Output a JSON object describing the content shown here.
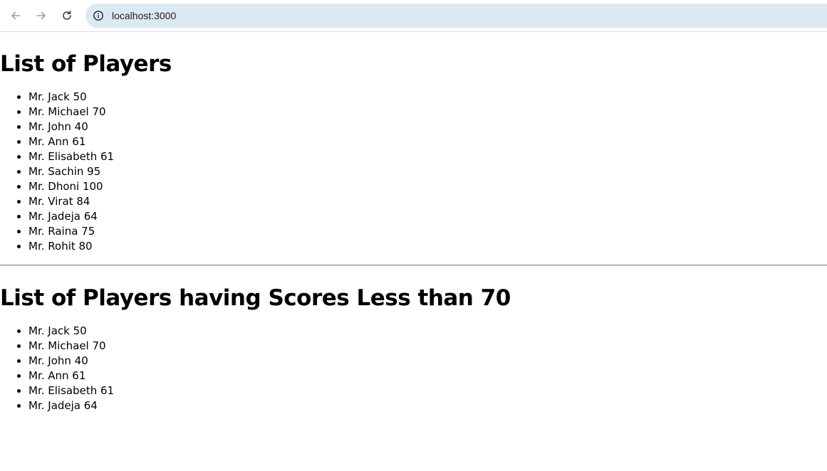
{
  "browser": {
    "url": "localhost:3000"
  },
  "section_all": {
    "title": "List of Players",
    "players": [
      "Mr. Jack 50",
      "Mr. Michael 70",
      "Mr. John 40",
      "Mr. Ann 61",
      "Mr. Elisabeth 61",
      "Mr. Sachin 95",
      "Mr. Dhoni 100",
      "Mr. Virat 84",
      "Mr. Jadeja 64",
      "Mr. Raina 75",
      "Mr. Rohit 80"
    ]
  },
  "section_filtered": {
    "title": "List of Players having Scores Less than 70",
    "players": [
      "Mr. Jack 50",
      "Mr. Michael 70",
      "Mr. John 40",
      "Mr. Ann 61",
      "Mr. Elisabeth 61",
      "Mr. Jadeja 64"
    ]
  },
  "icons": {
    "back": "arrow-left-icon",
    "forward": "arrow-right-icon",
    "reload": "reload-icon",
    "site_info": "info-icon"
  },
  "colors": {
    "omnibox_bg": "#dde9f0",
    "nav_icon_disabled": "#9aa0a6",
    "nav_icon_active": "#3c4043"
  }
}
